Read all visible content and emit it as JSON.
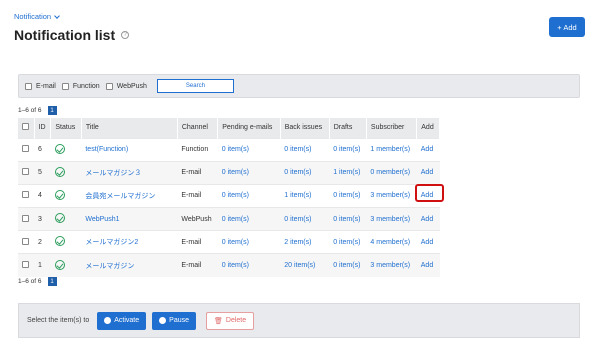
{
  "breadcrumb": "Notification",
  "page_title": "Notification list",
  "add_button": "+ Add",
  "filters": [
    "E-mail",
    "Function",
    "WebPush"
  ],
  "search_label": "Search",
  "count_text": "1–6 of 6",
  "page_number": "1",
  "columns": [
    "ID",
    "Status",
    "Title",
    "Channel",
    "Pending e-mails",
    "Back issues",
    "Drafts",
    "Subscriber",
    "Add"
  ],
  "rows": [
    {
      "id": "6",
      "title": "test(Function)",
      "channel": "Function",
      "pending": "0 item(s)",
      "back": "0 item(s)",
      "drafts": "0 item(s)",
      "subs": "1 member(s)",
      "add": "Add"
    },
    {
      "id": "5",
      "title": "メールマガジン３",
      "channel": "E-mail",
      "pending": "0 item(s)",
      "back": "0 item(s)",
      "drafts": "1 item(s)",
      "subs": "0 member(s)",
      "add": "Add"
    },
    {
      "id": "4",
      "title": "会員宛メールマガジン",
      "channel": "E-mail",
      "pending": "0 item(s)",
      "back": "1 item(s)",
      "drafts": "0 item(s)",
      "subs": "3 member(s)",
      "add": "Add"
    },
    {
      "id": "3",
      "title": "WebPush1",
      "channel": "WebPush",
      "pending": "0 item(s)",
      "back": "0 item(s)",
      "drafts": "0 item(s)",
      "subs": "3 member(s)",
      "add": "Add"
    },
    {
      "id": "2",
      "title": "メールマガジン2",
      "channel": "E-mail",
      "pending": "0 item(s)",
      "back": "2 item(s)",
      "drafts": "0 item(s)",
      "subs": "4 member(s)",
      "add": "Add"
    },
    {
      "id": "1",
      "title": "メールマガジン",
      "channel": "E-mail",
      "pending": "0 item(s)",
      "back": "20 item(s)",
      "drafts": "0 item(s)",
      "subs": "3 member(s)",
      "add": "Add"
    }
  ],
  "bulk": {
    "label": "Select the item(s) to",
    "activate": "Activate",
    "pause": "Pause",
    "delete": "Delete"
  },
  "colors": {
    "accent": "#1f6fd0",
    "status_ok": "#2a9d5c",
    "highlight": "#d01010"
  }
}
